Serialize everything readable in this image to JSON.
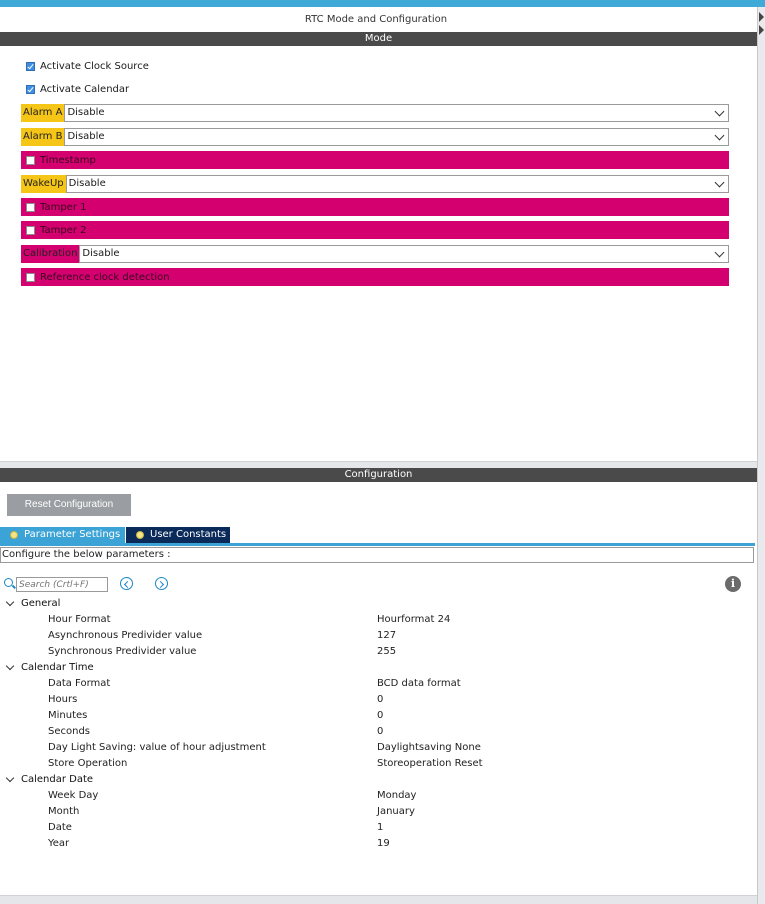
{
  "window": {
    "title": "RTC Mode and Configuration"
  },
  "mode": {
    "header": "Mode",
    "activate_clock_source": {
      "label": "Activate Clock Source",
      "checked": true
    },
    "activate_calendar": {
      "label": "Activate Calendar",
      "checked": true
    },
    "alarm_a": {
      "label": "Alarm A",
      "value": "Disable"
    },
    "alarm_b": {
      "label": "Alarm B",
      "value": "Disable"
    },
    "timestamp": {
      "label": "Timestamp",
      "checked": false
    },
    "wakeup": {
      "label": "WakeUp",
      "value": "Disable"
    },
    "tamper1": {
      "label": "Tamper 1",
      "checked": false
    },
    "tamper2": {
      "label": "Tamper 2",
      "checked": false
    },
    "calibration": {
      "label": "Calibration",
      "value": "Disable"
    },
    "ref_clock": {
      "label": "Reference clock detection",
      "checked": false
    }
  },
  "configuration": {
    "header": "Configuration",
    "reset_label": "Reset Configuration",
    "tabs": [
      {
        "label": "Parameter Settings",
        "active": true
      },
      {
        "label": "User Constants",
        "active": false
      }
    ],
    "hint": "Configure the below parameters :",
    "search": {
      "placeholder": "Search (Crtl+F)"
    },
    "info_glyph": "i",
    "groups": [
      {
        "name": "General",
        "params": [
          {
            "name": "Hour Format",
            "value": "Hourformat 24"
          },
          {
            "name": "Asynchronous Predivider value",
            "value": "127"
          },
          {
            "name": "Synchronous Predivider value",
            "value": "255"
          }
        ]
      },
      {
        "name": "Calendar Time",
        "params": [
          {
            "name": "Data Format",
            "value": "BCD data format"
          },
          {
            "name": "Hours",
            "value": "0"
          },
          {
            "name": "Minutes",
            "value": "0"
          },
          {
            "name": "Seconds",
            "value": "0"
          },
          {
            "name": "Day Light Saving: value of hour adjustment",
            "value": "Daylightsaving None"
          },
          {
            "name": "Store Operation",
            "value": "Storeoperation Reset"
          }
        ]
      },
      {
        "name": "Calendar Date",
        "params": [
          {
            "name": "Week Day",
            "value": "Monday"
          },
          {
            "name": "Month",
            "value": "January"
          },
          {
            "name": "Date",
            "value": "1"
          },
          {
            "name": "Year",
            "value": "19"
          }
        ]
      }
    ]
  },
  "colors": {
    "accent_blue": "#3ba3d6",
    "dark_tab": "#0a2a5a",
    "warning_yellow": "#f5c518",
    "conflict_pink": "#d4006f",
    "header_gray": "#4a4a4a"
  }
}
